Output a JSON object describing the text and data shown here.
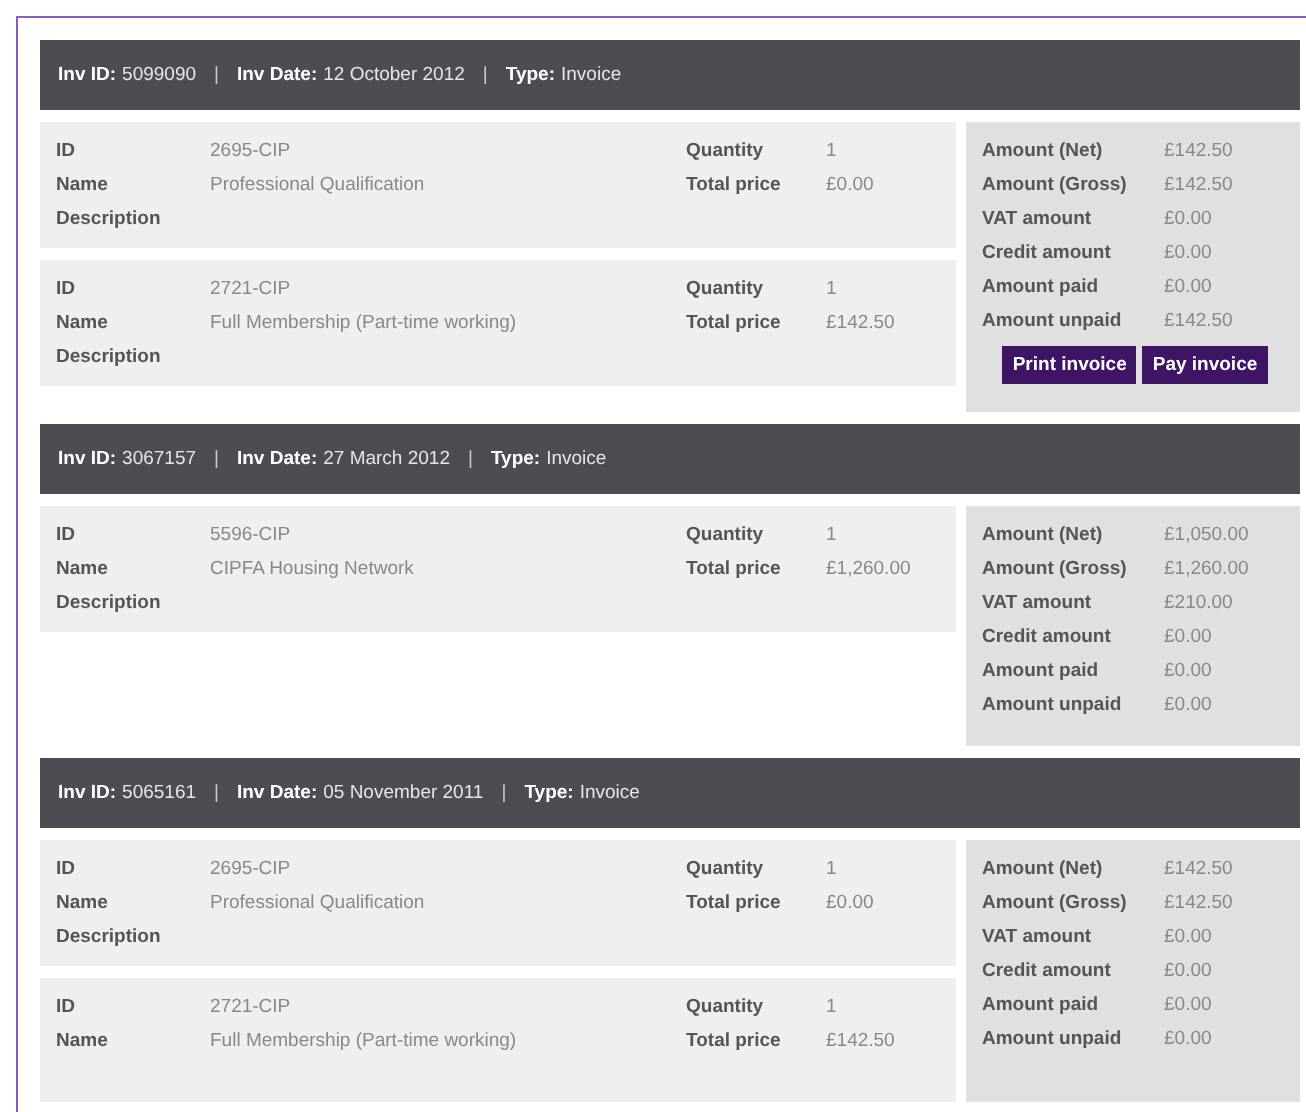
{
  "separator": "|",
  "invoices": [
    {
      "header": [
        {
          "label": "Inv ID:",
          "value": "5099090"
        },
        {
          "label": "Inv Date:",
          "value": "12 October 2012"
        },
        {
          "label": "Type:",
          "value": "Invoice"
        }
      ],
      "items": [
        {
          "left": [
            {
              "label": "ID",
              "value": "2695-CIP"
            },
            {
              "label": "Name",
              "value": "Professional Qualification"
            },
            {
              "label": "Description"
            }
          ],
          "right": [
            {
              "label": "Quantity",
              "value": "1"
            },
            {
              "label": "Total price",
              "value": "£0.00"
            }
          ]
        },
        {
          "left": [
            {
              "label": "ID",
              "value": "2721-CIP"
            },
            {
              "label": "Name",
              "value": "Full Membership (Part-time working)"
            },
            {
              "label": "Description"
            }
          ],
          "right": [
            {
              "label": "Quantity",
              "value": "1"
            },
            {
              "label": "Total price",
              "value": "£142.50"
            }
          ]
        }
      ],
      "summary": [
        {
          "label": "Amount (Net)",
          "value": "£142.50"
        },
        {
          "label": "Amount (Gross)",
          "value": "£142.50"
        },
        {
          "label": "VAT amount",
          "value": "£0.00"
        },
        {
          "label": "Credit amount",
          "value": "£0.00"
        },
        {
          "label": "Amount paid",
          "value": "£0.00"
        },
        {
          "label": "Amount unpaid",
          "value": "£142.50"
        }
      ],
      "buttons": [
        "Print invoice",
        "Pay invoice"
      ]
    },
    {
      "header": [
        {
          "label": "Inv ID:",
          "value": "3067157"
        },
        {
          "label": "Inv Date:",
          "value": "27 March 2012"
        },
        {
          "label": "Type:",
          "value": "Invoice"
        }
      ],
      "items": [
        {
          "left": [
            {
              "label": "ID",
              "value": "5596-CIP"
            },
            {
              "label": "Name",
              "value": "CIPFA Housing Network"
            },
            {
              "label": "Description"
            }
          ],
          "right": [
            {
              "label": "Quantity",
              "value": "1"
            },
            {
              "label": "Total price",
              "value": "£1,260.00"
            }
          ]
        }
      ],
      "summary": [
        {
          "label": "Amount (Net)",
          "value": "£1,050.00"
        },
        {
          "label": "Amount (Gross)",
          "value": "£1,260.00"
        },
        {
          "label": "VAT amount",
          "value": "£210.00"
        },
        {
          "label": "Credit amount",
          "value": "£0.00"
        },
        {
          "label": "Amount paid",
          "value": "£0.00"
        },
        {
          "label": "Amount unpaid",
          "value": "£0.00"
        }
      ]
    },
    {
      "header": [
        {
          "label": "Inv ID:",
          "value": "5065161"
        },
        {
          "label": "Inv Date:",
          "value": "05 November 2011"
        },
        {
          "label": "Type:",
          "value": "Invoice"
        }
      ],
      "items": [
        {
          "left": [
            {
              "label": "ID",
              "value": "2695-CIP"
            },
            {
              "label": "Name",
              "value": "Professional Qualification"
            },
            {
              "label": "Description"
            }
          ],
          "right": [
            {
              "label": "Quantity",
              "value": "1"
            },
            {
              "label": "Total price",
              "value": "£0.00"
            }
          ]
        },
        {
          "left": [
            {
              "label": "ID",
              "value": "2721-CIP"
            },
            {
              "label": "Name",
              "value": "Full Membership (Part-time working)"
            }
          ],
          "right": [
            {
              "label": "Quantity",
              "value": "1"
            },
            {
              "label": "Total price",
              "value": "£142.50"
            }
          ]
        }
      ],
      "summary": [
        {
          "label": "Amount (Net)",
          "value": "£142.50"
        },
        {
          "label": "Amount (Gross)",
          "value": "£142.50"
        },
        {
          "label": "VAT amount",
          "value": "£0.00"
        },
        {
          "label": "Credit amount",
          "value": "£0.00"
        },
        {
          "label": "Amount paid",
          "value": "£0.00"
        },
        {
          "label": "Amount unpaid",
          "value": "£0.00"
        }
      ]
    }
  ]
}
